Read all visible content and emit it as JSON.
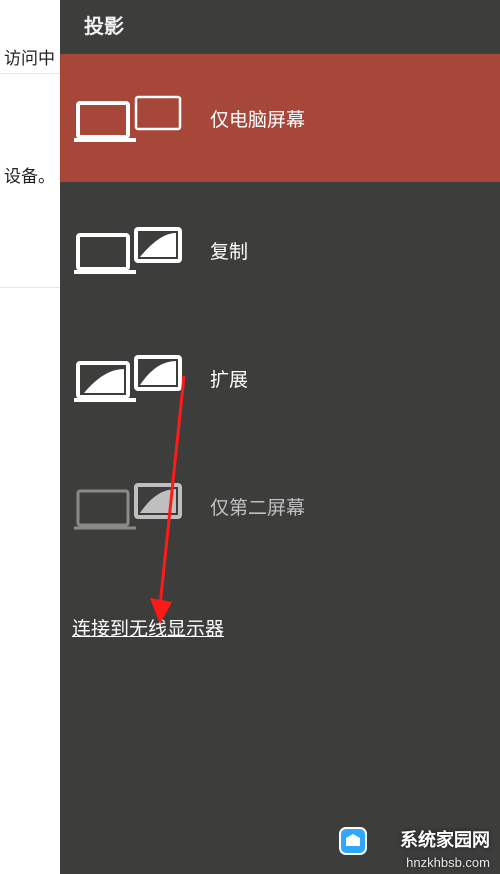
{
  "background": {
    "item1": "访问中",
    "item2": "设备。"
  },
  "panel": {
    "title": "投影",
    "options": [
      {
        "label": "仅电脑屏幕",
        "selected": true,
        "dim": false
      },
      {
        "label": "复制",
        "selected": false,
        "dim": false
      },
      {
        "label": "扩展",
        "selected": false,
        "dim": false
      },
      {
        "label": "仅第二屏幕",
        "selected": false,
        "dim": true
      }
    ],
    "wireless_link": "连接到无线显示器"
  },
  "watermark": {
    "text": "系统家园网",
    "url": "hnzkhbsb.com"
  },
  "colors": {
    "panel_bg": "#3d3d3c",
    "selected_bg": "#a64739",
    "arrow": "#ff1a1a"
  }
}
